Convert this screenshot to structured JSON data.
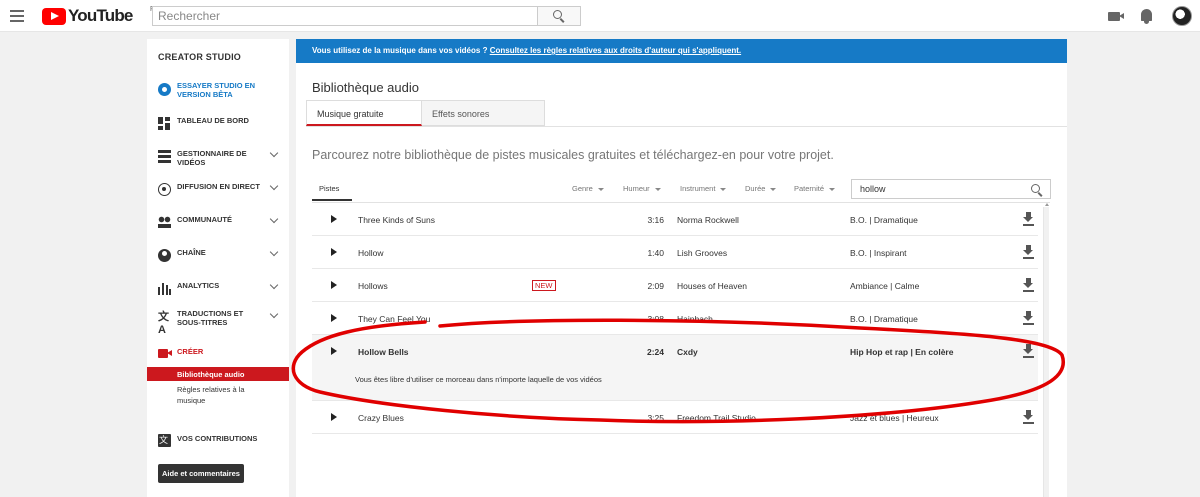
{
  "header": {
    "logo_text": "YouTube",
    "country_code": "FR",
    "search_placeholder": "Rechercher"
  },
  "sidebar": {
    "title": "CREATOR STUDIO",
    "items": [
      {
        "label": "ESSAYER STUDIO EN VERSION BÊTA",
        "icon": "gear-icon"
      },
      {
        "label": "TABLEAU DE BORD",
        "icon": "dashboard-icon"
      },
      {
        "label": "GESTIONNAIRE DE VIDÉOS",
        "icon": "video-manager-icon"
      },
      {
        "label": "DIFFUSION EN DIRECT",
        "icon": "live-icon"
      },
      {
        "label": "COMMUNAUTÉ",
        "icon": "community-icon"
      },
      {
        "label": "CHAÎNE",
        "icon": "channel-icon"
      },
      {
        "label": "ANALYTICS",
        "icon": "analytics-icon"
      },
      {
        "label": "TRADUCTIONS ET SOUS-TITRES",
        "icon": "translate-icon"
      },
      {
        "label": "CRÉER",
        "icon": "create-icon"
      },
      {
        "label": "VOS CONTRIBUTIONS",
        "icon": "contributions-icon"
      }
    ],
    "sub_active": "Bibliothèque audio",
    "sub_other": "Règles relatives à la musique",
    "help_button": "Aide et commentaires"
  },
  "main": {
    "banner_text": "Vous utilisez de la musique dans vos vidéos ?",
    "banner_link": "Consultez les règles relatives aux droits d'auteur qui s'appliquent.",
    "page_title": "Bibliothèque audio",
    "tabs": [
      "Musique gratuite",
      "Effets sonores"
    ],
    "intro": "Parcourez notre bibliothèque de pistes musicales gratuites et téléchargez-en pour votre projet.",
    "filter_tab": "Pistes",
    "filters": [
      "Genre",
      "Humeur",
      "Instrument",
      "Durée",
      "Paternité"
    ],
    "search_value": "hollow",
    "tracks": [
      {
        "title": "Three Kinds of Suns",
        "duration": "3:16",
        "artist": "Norma Rockwell",
        "genre": "B.O. | Dramatique"
      },
      {
        "title": "Hollow",
        "duration": "1:40",
        "artist": "Lish Grooves",
        "genre": "B.O. | Inspirant"
      },
      {
        "title": "Hollows",
        "badge": "NEW",
        "duration": "2:09",
        "artist": "Houses of Heaven",
        "genre": "Ambiance | Calme"
      },
      {
        "title": "They Can Feel You",
        "duration": "3:08",
        "artist": "Hainbach",
        "genre": "B.O. | Dramatique"
      },
      {
        "title": "Hollow Bells",
        "duration": "2:24",
        "artist": "Cxdy",
        "genre": "Hip Hop et rap | En colère",
        "description": "Vous êtes libre d'utiliser ce morceau dans n'importe laquelle de vos vidéos"
      },
      {
        "title": "Crazy Blues",
        "duration": "3:25",
        "artist": "Freedom Trail Studio",
        "genre": "Jazz et blues | Heureux"
      }
    ]
  },
  "colors": {
    "brand_red": "#cc181e",
    "banner_blue": "#167ac6",
    "annotation_red": "#e00000"
  }
}
